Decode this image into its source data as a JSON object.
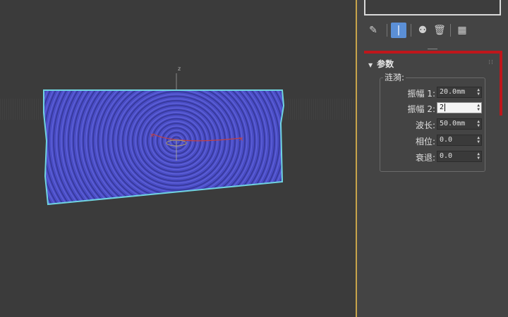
{
  "viewport": {
    "axis_label": "z"
  },
  "command_panel": {
    "tabs": [
      {
        "name": "pin-stack",
        "icon": "pin-icon",
        "glyph": "✎",
        "active": false
      },
      {
        "name": "show-end-result",
        "icon": "show-end-result-icon",
        "glyph": "|",
        "active": true
      },
      {
        "name": "make-unique",
        "icon": "make-unique-icon",
        "glyph": "⚉",
        "active": false
      },
      {
        "name": "remove-modifier",
        "icon": "trash-icon",
        "glyph": "🗑",
        "active": false
      },
      {
        "name": "configure-sets",
        "icon": "configure-icon",
        "glyph": "▦",
        "active": false
      }
    ],
    "accent_color": "#5b8fd6",
    "highlight_color": "#c0161b"
  },
  "params": {
    "header": "参数",
    "group_title": "涟漪:",
    "fields": [
      {
        "label": "振幅 1:",
        "value": "20.0mm",
        "editing": false
      },
      {
        "label": "振幅 2:",
        "value": "2",
        "editing": true
      },
      {
        "label": "波长:",
        "value": "50.0mm",
        "editing": false
      },
      {
        "label": "相位:",
        "value": "0.0",
        "editing": false
      },
      {
        "label": "衰退:",
        "value": "0.0",
        "editing": false
      }
    ]
  }
}
